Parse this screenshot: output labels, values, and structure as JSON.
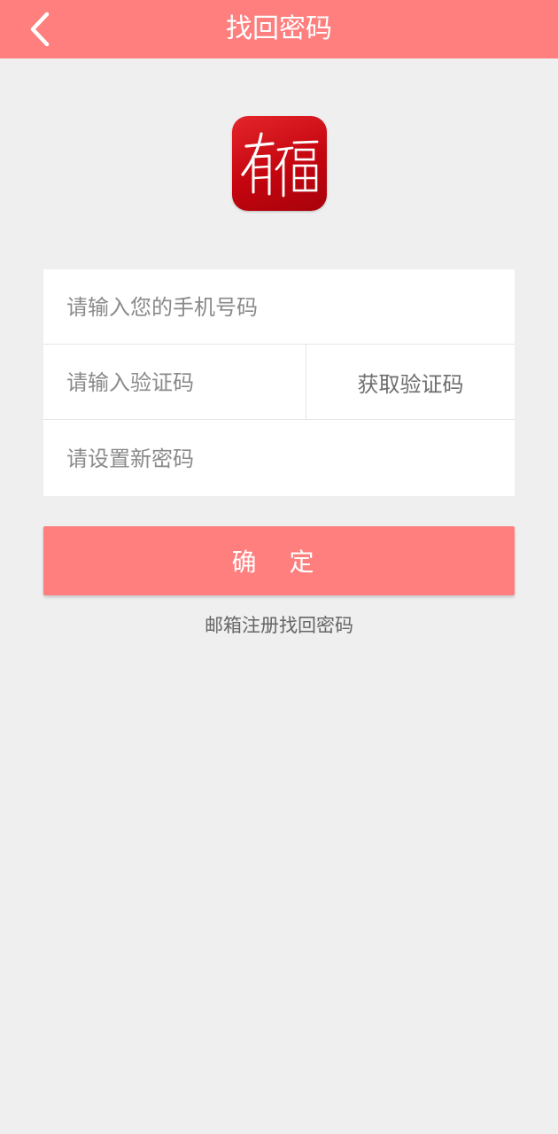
{
  "header": {
    "title": "找回密码",
    "back_icon": "chevron-left-icon",
    "background_color": "#ff7e7e"
  },
  "logo": {
    "text": "有福",
    "color": "#d20f18"
  },
  "form": {
    "phone_placeholder": "请输入您的手机号码",
    "code_placeholder": "请输入验证码",
    "get_code_label": "获取验证码",
    "password_placeholder": "请设置新密码"
  },
  "actions": {
    "confirm_label": "确 定",
    "email_recover_label": "邮箱注册找回密码"
  }
}
